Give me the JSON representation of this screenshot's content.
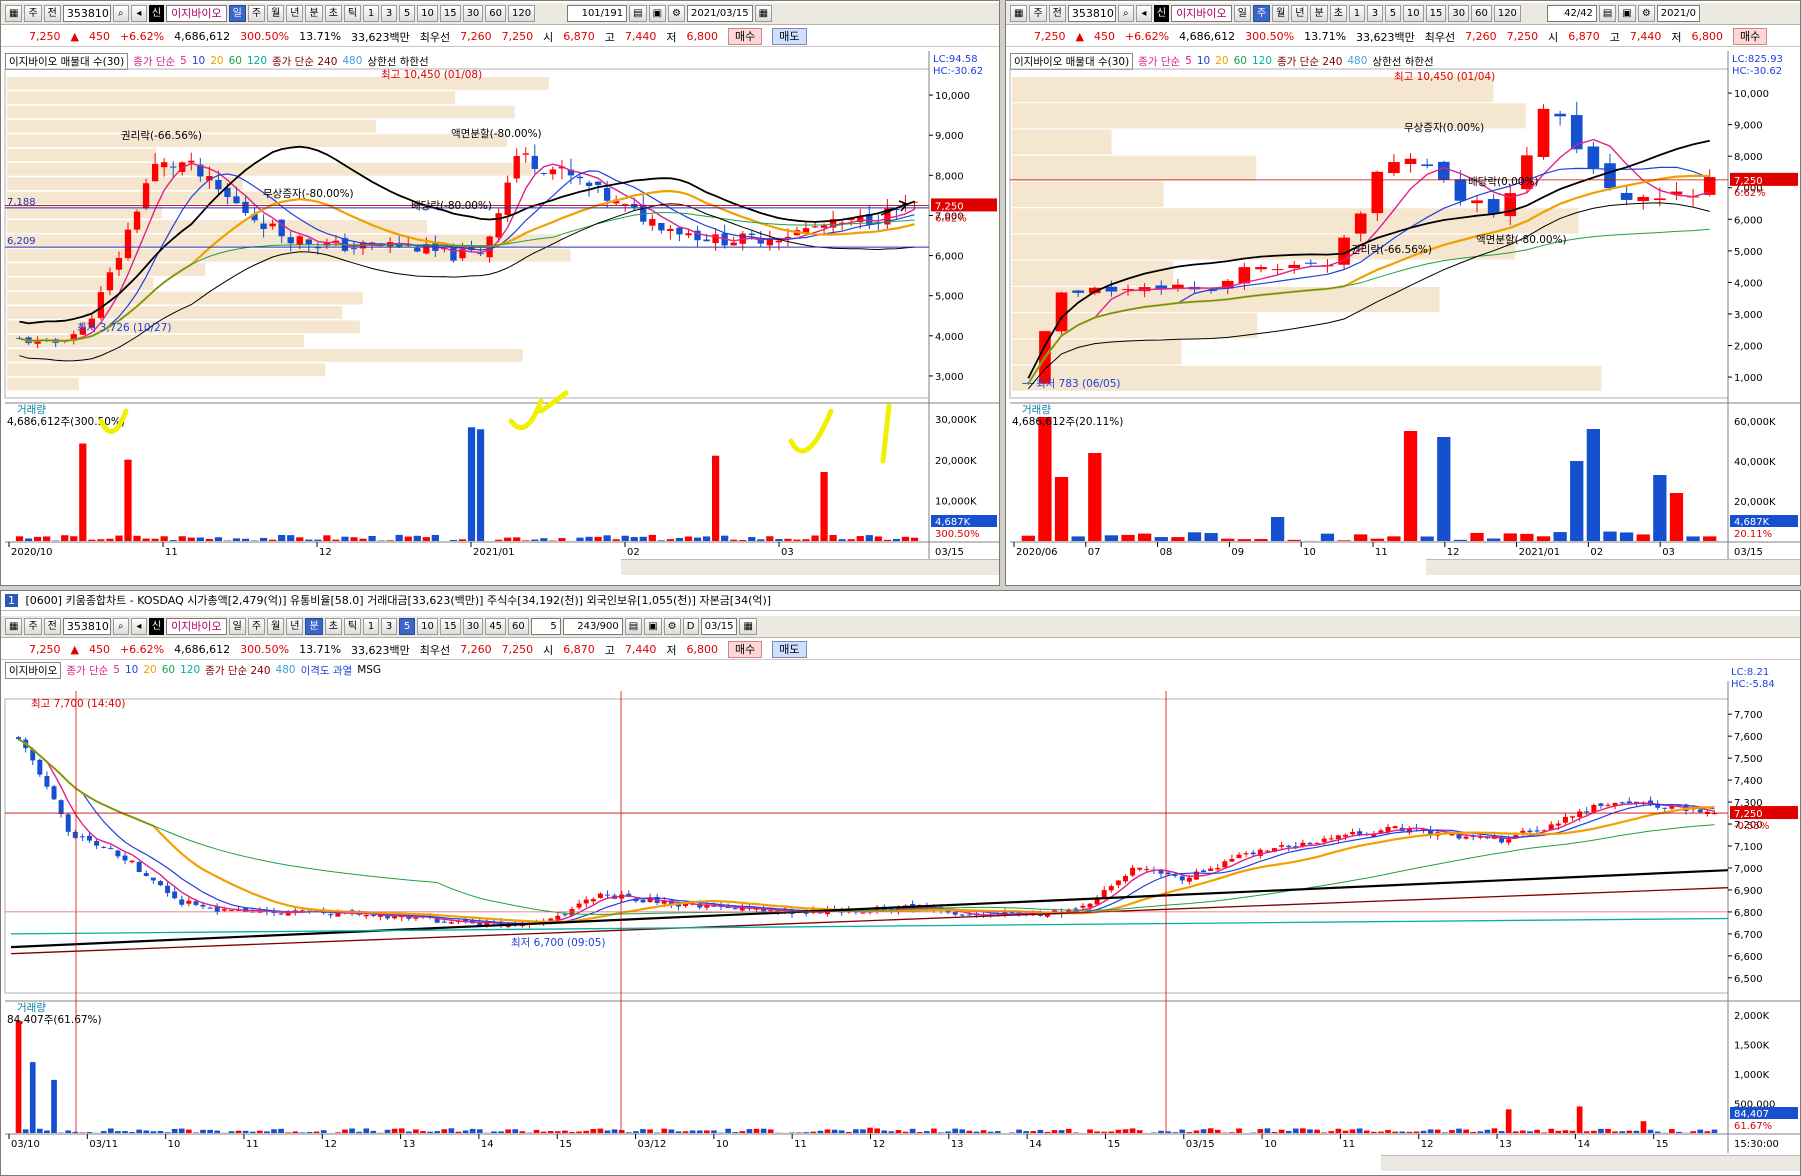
{
  "stock": {
    "code": "353810",
    "name": "이지바이오",
    "price": "7,250",
    "price_arrow": "▲",
    "change": "450",
    "change_pct": "+6.62%",
    "volume": "4,686,612",
    "volume_ratio": "300.50%",
    "turnover": "13.71%",
    "amount": "33,623백만",
    "best_ask_label": "최우선",
    "best_ask": "7,260",
    "best_bid": "7,250",
    "open_label": "시",
    "open": "6,870",
    "high_label": "고",
    "high": "7,440",
    "low_label": "저",
    "low": "6,800",
    "buy_btn": "매수",
    "sell_btn": "매도"
  },
  "toolbar": {
    "periods": [
      "일",
      "주",
      "월",
      "년",
      "분",
      "초",
      "틱"
    ],
    "units": [
      "1",
      "3",
      "5",
      "10",
      "15",
      "30",
      "45",
      "60",
      "120"
    ],
    "market_sel": "주",
    "scope_sel": "전",
    "new_label": "신",
    "gear": "⚙"
  },
  "win_daily": {
    "counter": "101/191",
    "date": "2021/03/15",
    "legend_name": "이지바이오 매물대 수(30)",
    "legend_ma": "종가 단순",
    "ma_periods": [
      "5",
      "10",
      "20",
      "60",
      "120"
    ],
    "legend_ma2": "종가 단순 240",
    "ma2_extra": "480",
    "legend_limit": "상한선 하한선",
    "lc": "LC:94.58",
    "hc": "HC:-30.62",
    "y_labels": [
      "10,000",
      "9,000",
      "8,000",
      "7,000",
      "6,000",
      "5,000",
      "4,000",
      "3,000"
    ],
    "hline_labels": [
      "7,188",
      "6,209"
    ],
    "price_tag": "7,250",
    "pct_tag": "6.62%",
    "ann_high": "최고 10,450 (01/08)",
    "ann_low": "최저 3,726 (10/27)",
    "ann_rights": "권리락(-66.56%)",
    "ann_split": "액면분할(-80.00%)",
    "ann_bonus": "무상증자(-80.00%)",
    "ann_div": "배당락(-80.00%)",
    "vol_title": "거래량",
    "vol_value": "4,686,612주(300.50%)",
    "vol_y": [
      "30,000K",
      "20,000K",
      "10,000K"
    ],
    "vol_tag": "4,687K",
    "vol_pct": "300.50%",
    "x_labels": [
      "2020/10",
      "11",
      "12",
      "2021/01",
      "02",
      "03"
    ],
    "x_end": "03/15"
  },
  "win_weekly": {
    "counter": "42/42",
    "date": "2021/0",
    "legend_name": "이지바이오 매물대 수(30)",
    "legend_ma": "종가 단순",
    "ma_periods": [
      "5",
      "10",
      "20",
      "60",
      "120"
    ],
    "legend_ma2": "종가 단순 240",
    "ma2_extra": "480",
    "legend_limit": "상한선 하한선",
    "lc": "LC:825.93",
    "hc": "HC:-30.62",
    "y_labels": [
      "10,000",
      "9,000",
      "8,000",
      "7,000",
      "6,000",
      "5,000",
      "4,000",
      "3,000",
      "2,000",
      "1,000"
    ],
    "price_tag": "7,250",
    "pct_tag": "6.62%",
    "ann_high": "최고 10,450 (01/04)",
    "ann_low": "최저 783 (06/05)",
    "ann_bonus": "무상증자(0.00%)",
    "ann_div": "배당락(0.00%)",
    "ann_rights": "권리락(-66.56%)",
    "ann_split": "액면분할(-80.00%)",
    "vol_title": "거래량",
    "vol_value": "4,686,612주(20.11%)",
    "vol_y": [
      "60,000K",
      "40,000K",
      "20,000K"
    ],
    "vol_tag": "4,687K",
    "vol_pct": "20.11%",
    "x_labels": [
      "2020/06",
      "07",
      "08",
      "09",
      "10",
      "11",
      "12",
      "2021/01",
      "02",
      "03"
    ],
    "x_end": "03/15"
  },
  "win_minute": {
    "title_idx": "1",
    "title": "[0600] 키움종합차트 - KOSDAQ 시가총액[2,479(억)] 유통비율[58.0] 거래대금[33,623(백만)] 주식수[34,192(천)] 외국인보유[1,055(천)] 자본금[34(억)]",
    "counter": "243/900",
    "unit_sel": "5",
    "date": "03/15",
    "check_label": "D",
    "legend_name": "이지바이오",
    "legend_ma": "종가 단순",
    "ma_periods": [
      "5",
      "10",
      "20",
      "60",
      "120"
    ],
    "legend_ma2": "종가 단순 240",
    "ma2_extra": "480",
    "legend_extra": "이격도 과열",
    "legend_msg": "MSG",
    "lc": "LC:8.21",
    "hc": "HC:-5.84",
    "y_labels": [
      "7,700",
      "7,600",
      "7,500",
      "7,400",
      "7,300",
      "7,200",
      "7,100",
      "7,000",
      "6,900",
      "6,800",
      "6,700",
      "6,600",
      "6,500"
    ],
    "price_tag": "7,250",
    "pct_tag": "-0.55%",
    "ann_high": "최고 7,700 (14:40)",
    "ann_low": "최저 6,700 (09:05)",
    "vol_title": "거래량",
    "vol_value": "84,407주(61.67%)",
    "vol_y": [
      "2,000K",
      "1,500K",
      "1,000K",
      "500,000"
    ],
    "vol_tag": "84,407",
    "vol_pct": "61.67%",
    "x_labels": [
      "03/10",
      "03/11",
      "10",
      "11",
      "12",
      "13",
      "14",
      "15",
      "03/12",
      "10",
      "11",
      "12",
      "13",
      "14",
      "15",
      "03/15",
      "10",
      "11",
      "12",
      "13",
      "14",
      "15"
    ],
    "x_end": "15:30:00"
  },
  "colors": {
    "up": "#ff0000",
    "down": "#1450d0",
    "ma5": "#e0208c",
    "ma10": "#2040e0",
    "ma20": "#f0a000",
    "ma60": "#20a040",
    "ma120": "#00b0a0",
    "band": "#000000",
    "vprofile": "#f5e6d0",
    "highlight": "#f0f000"
  }
}
